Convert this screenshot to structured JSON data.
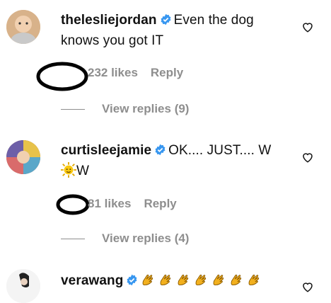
{
  "comments": [
    {
      "username": "theleslie jordan",
      "username_display": "thelesliejordan",
      "text_line1": "Even the dog",
      "text_line2": "knows you got IT",
      "likes": "232 likes",
      "reply": "Reply",
      "view_replies": "View replies (9)"
    },
    {
      "username_display": "curtisleejamie",
      "text_line1": "OK.... JUST.... W",
      "text_line2_suffix": "W",
      "likes": "81 likes",
      "reply": "Reply",
      "view_replies": "View replies (4)"
    },
    {
      "username_display": "verawang",
      "emoji_row": "clap-emoji x7"
    }
  ],
  "colors": {
    "verified": "#3897f0",
    "meta_text": "#8e8e8e",
    "clap": "#f2b01e"
  },
  "icons": [
    "verified-badge-icon",
    "heart-icon",
    "sun-emoji-icon",
    "clap-emoji-icon"
  ]
}
